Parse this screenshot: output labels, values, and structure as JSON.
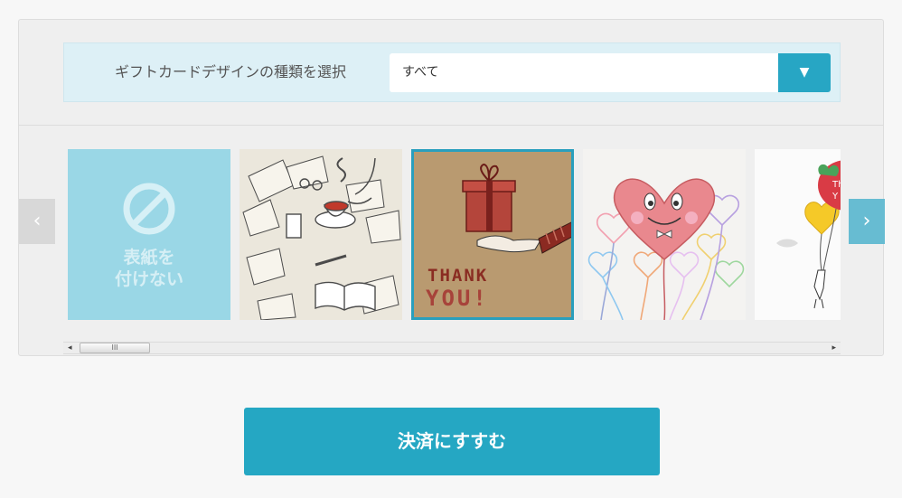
{
  "filter": {
    "label": "ギフトカードデザインの種類を選択",
    "selected_value": "すべて",
    "arrow_icon": "▼"
  },
  "cards": {
    "none": {
      "label_line1": "表紙を",
      "label_line2": "付けない"
    },
    "thanks": {
      "text_line1": "THANK",
      "text_line2": "YOU!"
    },
    "balloon": {
      "text_line1": "Th",
      "text_line2": "Y"
    }
  },
  "nav": {
    "prev_icon": "‹",
    "next_icon": "›"
  },
  "scrollbar": {
    "left_arrow": "◂",
    "right_arrow": "▸",
    "grip": "III"
  },
  "checkout": {
    "label": "決済にすすむ"
  },
  "colors": {
    "accent": "#25a7c3",
    "light_blue": "#9ad7e6",
    "filter_bg": "#ddf0f6"
  }
}
